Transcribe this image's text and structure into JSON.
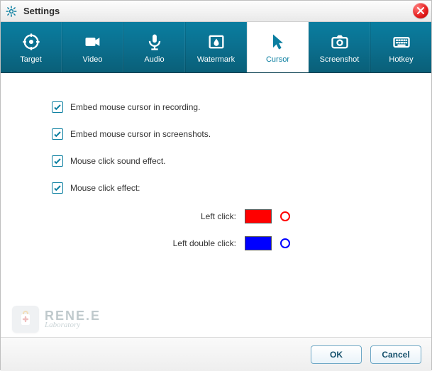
{
  "window": {
    "title": "Settings"
  },
  "tabs": [
    {
      "key": "target",
      "label": "Target"
    },
    {
      "key": "video",
      "label": "Video"
    },
    {
      "key": "audio",
      "label": "Audio"
    },
    {
      "key": "watermark",
      "label": "Watermark"
    },
    {
      "key": "cursor",
      "label": "Cursor"
    },
    {
      "key": "screenshot",
      "label": "Screenshot"
    },
    {
      "key": "hotkey",
      "label": "Hotkey"
    }
  ],
  "active_tab": "cursor",
  "cursor_settings": {
    "embed_recording": {
      "label": "Embed mouse cursor in recording.",
      "checked": true
    },
    "embed_screenshots": {
      "label": "Embed mouse cursor in screenshots.",
      "checked": true
    },
    "click_sound": {
      "label": "Mouse click sound effect.",
      "checked": true
    },
    "click_effect": {
      "label": "Mouse click effect:",
      "checked": true
    },
    "left_click": {
      "label": "Left click:",
      "color": "#ff0000"
    },
    "left_double_click": {
      "label": "Left double click:",
      "color": "#0000ff"
    }
  },
  "brand": {
    "line1": "RENE.E",
    "line2": "Laboratory"
  },
  "footer": {
    "ok": "OK",
    "cancel": "Cancel"
  }
}
